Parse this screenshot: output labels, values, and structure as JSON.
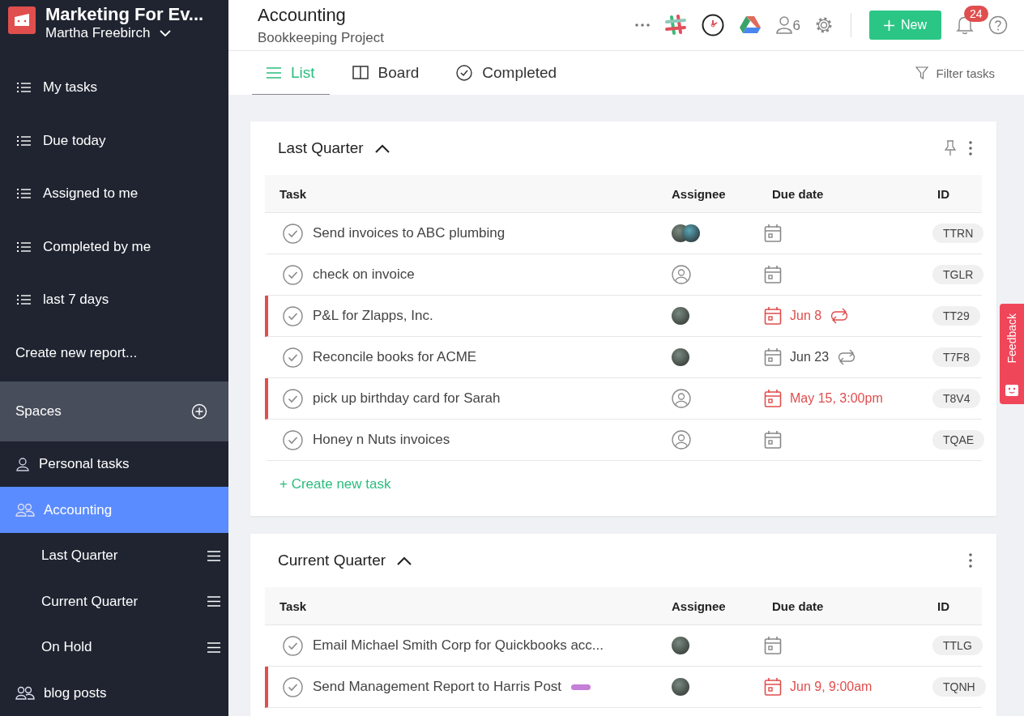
{
  "workspace": {
    "name": "Marketing For Ev...",
    "user": "Martha Freebirch"
  },
  "sidebar": {
    "reports": [
      {
        "label": "My tasks"
      },
      {
        "label": "Due today"
      },
      {
        "label": "Assigned to me"
      },
      {
        "label": "Completed by me"
      },
      {
        "label": "last 7 days"
      }
    ],
    "create_report": "Create new report...",
    "spaces_label": "Spaces",
    "spaces": [
      {
        "label": "Personal tasks",
        "kind": "personal",
        "selected": false
      },
      {
        "label": "Accounting",
        "kind": "team",
        "selected": true,
        "children": [
          {
            "label": "Last Quarter"
          },
          {
            "label": "Current Quarter"
          },
          {
            "label": "On Hold"
          }
        ]
      },
      {
        "label": "blog posts",
        "kind": "team",
        "selected": false
      }
    ]
  },
  "header": {
    "title": "Accounting",
    "subtitle": "Bookkeeping Project",
    "members": "6",
    "new_button": "New",
    "notifications": "24"
  },
  "tabs": [
    {
      "label": "List",
      "kind": "list",
      "selected": true
    },
    {
      "label": "Board",
      "kind": "board",
      "selected": false
    },
    {
      "label": "Completed",
      "kind": "completed",
      "selected": false
    }
  ],
  "filter": "Filter tasks",
  "sections": [
    {
      "title": "Last Quarter",
      "expanded": true,
      "pinned": true,
      "columns": [
        "Task",
        "Assignee",
        "Due date",
        "ID"
      ],
      "create_link": "+ Create new task",
      "tasks": [
        {
          "title": "Send invoices to ABC plumbing",
          "assignees": [
            {
              "kind": "picture"
            },
            {
              "kind": "picture"
            }
          ],
          "overdue": false,
          "recurring": false,
          "id": "TTRN"
        },
        {
          "title": "check on invoice",
          "overdue": false,
          "recurring": false,
          "id": "TGLR"
        },
        {
          "title": "P&L for Zlapps, Inc.",
          "assignees": [
            {
              "kind": "picture"
            }
          ],
          "due": "Jun 8",
          "overdue": true,
          "recurring": true,
          "id": "TT29"
        },
        {
          "title": "Reconcile books for ACME",
          "assignees": [
            {
              "kind": "picture"
            }
          ],
          "due": "Jun 23",
          "overdue": false,
          "recurring": true,
          "id": "T7F8"
        },
        {
          "title": "pick up birthday card for Sarah",
          "due": "May 15, 3:00pm",
          "overdue": true,
          "recurring": false,
          "id": "T8V4"
        },
        {
          "title": "Honey n Nuts invoices",
          "overdue": false,
          "recurring": false,
          "id": "TQAE"
        }
      ]
    },
    {
      "title": "Current Quarter",
      "expanded": true,
      "pinned": false,
      "columns": [
        "Task",
        "Assignee",
        "Due date",
        "ID"
      ],
      "tasks": [
        {
          "title": "Email Michael Smith Corp for Quickbooks acc...",
          "assignees": [
            {
              "kind": "picture"
            }
          ],
          "overdue": false,
          "recurring": false,
          "id": "TTLG"
        },
        {
          "title": "Send Management Report to Harris Post",
          "assignees": [
            {
              "kind": "picture"
            }
          ],
          "due": "Jun 9, 9:00am",
          "overdue": true,
          "recurring": false,
          "id": "TQNH",
          "tags": [
            {
              "color": "#c47fd6"
            }
          ]
        }
      ]
    }
  ],
  "feedback": "Feedback"
}
